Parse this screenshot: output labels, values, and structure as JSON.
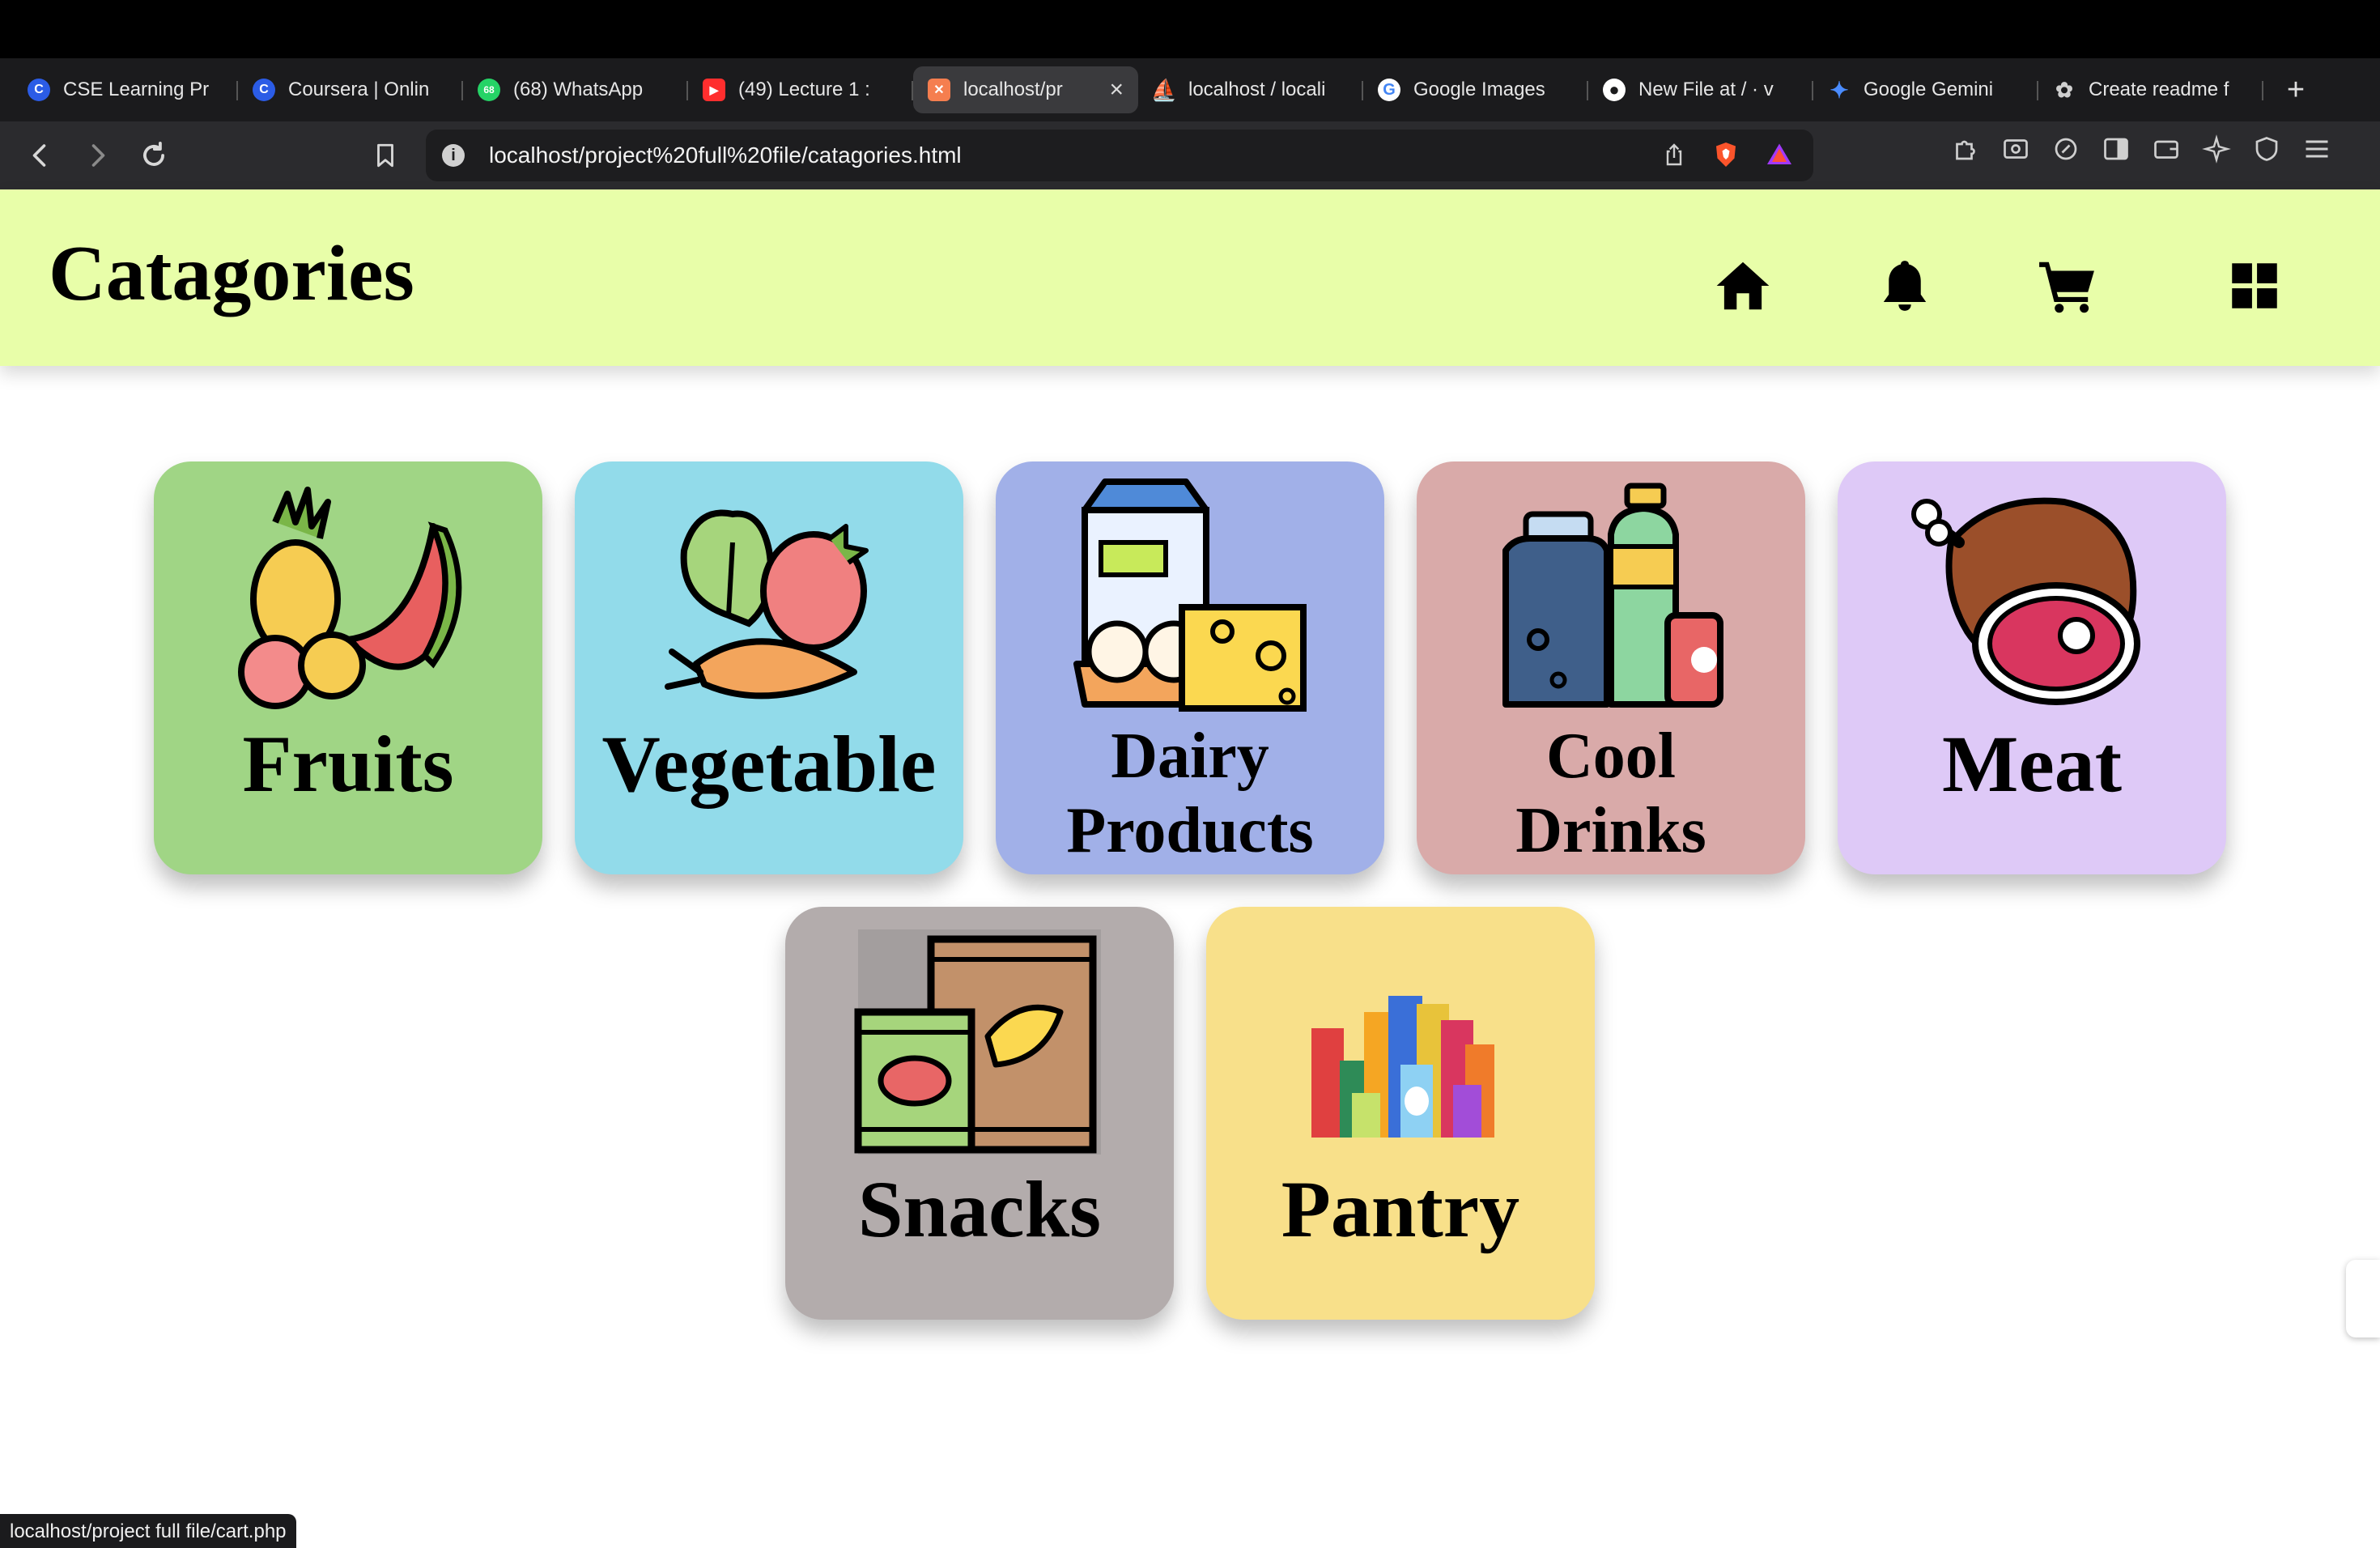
{
  "browser": {
    "tabs": [
      {
        "label": "CSE Learning Pr",
        "fav_color": "#2b5ce6",
        "fav_glyph": "C"
      },
      {
        "label": "Coursera | Onlin",
        "fav_color": "#2b5ce6",
        "fav_glyph": "C"
      },
      {
        "label": "(68) WhatsApp",
        "fav_color": "#25d366",
        "fav_glyph": "68"
      },
      {
        "label": "(49) Lecture 1 :",
        "fav_color": "#ff2e2e",
        "fav_glyph": "▶"
      },
      {
        "label": "localhost/pr",
        "fav_color": "#f57e4f",
        "fav_glyph": "✕",
        "active": true
      },
      {
        "label": "localhost / locali",
        "fav_color": "#e58a2c",
        "fav_glyph": "⛵"
      },
      {
        "label": "Google Images",
        "fav_color": "#4285f4",
        "fav_glyph": "G"
      },
      {
        "label": "New File at / · v",
        "fav_color": "#ffffff",
        "fav_glyph": "●"
      },
      {
        "label": "Google Gemini",
        "fav_color": "#4a8cff",
        "fav_glyph": "✦"
      },
      {
        "label": "Create readme f",
        "fav_color": "#cfcfcf",
        "fav_glyph": "✿"
      }
    ],
    "new_tab_glyph": "+",
    "close_glyph": "×",
    "url": "localhost/project%20full%20file/catagories.html",
    "status_text": "localhost/project full file/cart.php"
  },
  "page": {
    "title": "Catagories",
    "icons": [
      "home-icon",
      "bell-icon",
      "cart-icon",
      "grid-icon"
    ]
  },
  "categories": [
    {
      "name": "Fruits",
      "color": "#a0d585"
    },
    {
      "name": "Vegetable",
      "color": "#92dbea"
    },
    {
      "name_line1": "Dairy",
      "name_line2": "Products",
      "color": "#a1b0e8"
    },
    {
      "name_line1": "Cool",
      "name_line2": "Drinks",
      "color": "#d9aaa9"
    },
    {
      "name": "Meat",
      "color": "#dec9f7"
    },
    {
      "name": "Snacks",
      "color": "#b3acac"
    },
    {
      "name": "Pantry",
      "color": "#f8e08a"
    }
  ]
}
